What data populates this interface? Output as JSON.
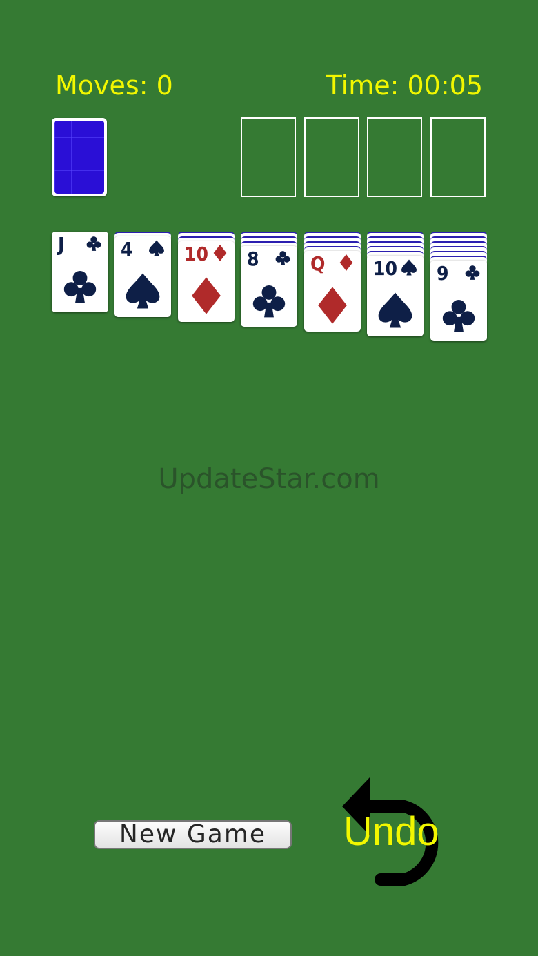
{
  "hud": {
    "moves": "Moves: 0",
    "time": "Time: 00:05"
  },
  "stock": {
    "icon": "card-back-icon"
  },
  "foundations": [
    "",
    "",
    "",
    ""
  ],
  "tableau": [
    {
      "hidden": 0,
      "rank": "J",
      "suit": "club",
      "color": "black"
    },
    {
      "hidden": 1,
      "rank": "4",
      "suit": "spade",
      "color": "black"
    },
    {
      "hidden": 2,
      "rank": "10",
      "suit": "diamond",
      "color": "red"
    },
    {
      "hidden": 3,
      "rank": "8",
      "suit": "club",
      "color": "black"
    },
    {
      "hidden": 4,
      "rank": "Q",
      "suit": "diamond",
      "color": "red"
    },
    {
      "hidden": 5,
      "rank": "10",
      "suit": "spade",
      "color": "black"
    },
    {
      "hidden": 6,
      "rank": "9",
      "suit": "club",
      "color": "black"
    }
  ],
  "watermark": "UpdateStar.com",
  "buttons": {
    "new_game": "New Game",
    "undo": "Undo"
  },
  "colors": {
    "felt": "#357a33",
    "hud_text": "#f2f700",
    "card_back": "#2a0fd6",
    "red_suit": "#b02a2a",
    "black_suit": "#0e1f47"
  }
}
